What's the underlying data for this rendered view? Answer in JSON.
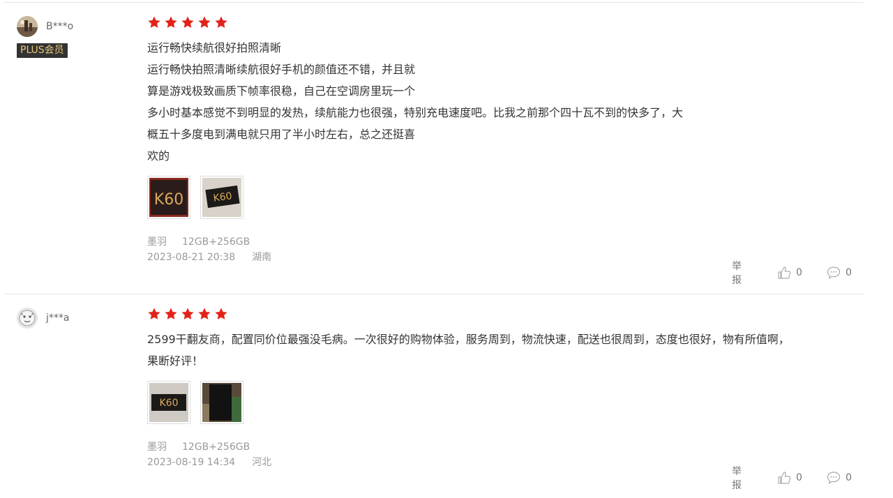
{
  "reviews": [
    {
      "username": "B***o",
      "badge": "PLUS会员",
      "rating": 5,
      "content_lines": [
        "运行畅快续航很好拍照清晰",
        "运行畅快拍照清晰续航很好手机的颜值还不错，并且就",
        "算是游戏极致画质下帧率很稳，自己在空调房里玩一个",
        "多小时基本感觉不到明显的发热，续航能力也很强，特别充电速度吧。比我之前那个四十瓦不到的快多了，大",
        "概五十多度电到满电就只用了半小时左右，总之还挺喜",
        "欢的"
      ],
      "images": [
        "K60",
        "K60"
      ],
      "color": "墨羽",
      "spec": "12GB+256GB",
      "date": "2023-08-21 20:38",
      "location": "湖南",
      "report_label": "举报",
      "likes": "0",
      "comments": "0"
    },
    {
      "username": "j***a",
      "badge": "",
      "rating": 5,
      "content_lines": [
        "2599干翻友商，配置同价位最强没毛病。一次很好的购物体验，服务周到，物流快速，配送也很周到，态度也很好，物有所值啊，",
        "果断好评！"
      ],
      "images": [
        "K60",
        ""
      ],
      "color": "墨羽",
      "spec": "12GB+256GB",
      "date": "2023-08-19 14:34",
      "location": "河北",
      "report_label": "举报",
      "likes": "0",
      "comments": "0"
    }
  ],
  "colors": {
    "star": "#e2231a",
    "badge_bg": "#333333",
    "badge_text": "#e8c97a",
    "meta_text": "#999999"
  },
  "icons": {
    "like": "thumbs-up-icon",
    "comment": "speech-bubble-icon"
  }
}
